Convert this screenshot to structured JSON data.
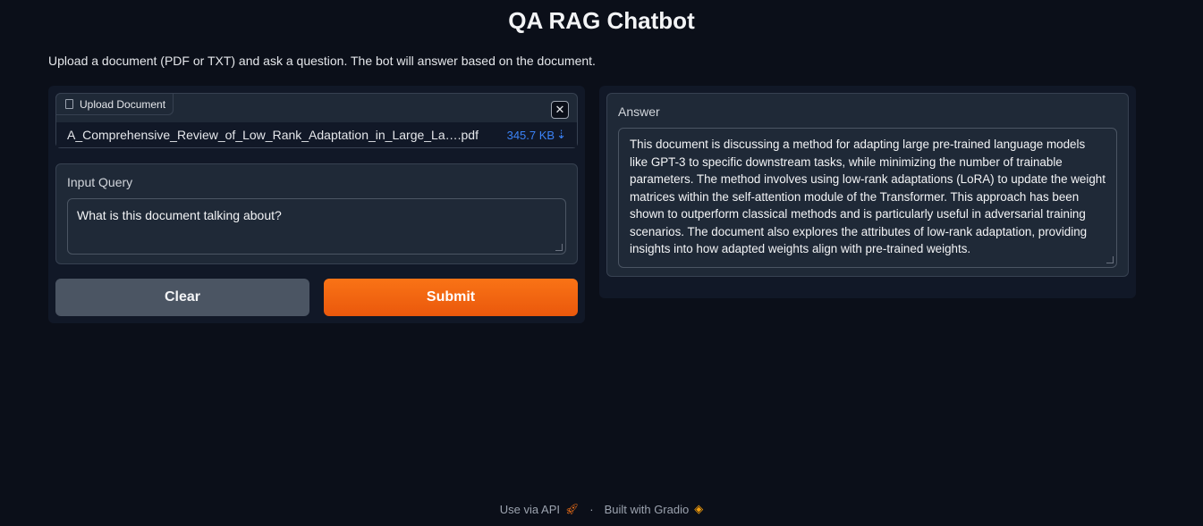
{
  "app": {
    "title": "QA RAG Chatbot",
    "description": "Upload a document (PDF or TXT) and ask a question. The bot will answer based on the document."
  },
  "upload": {
    "label": "Upload Document",
    "file_name": "A_Comprehensive_Review_of_Low_Rank_Adaptation_in_Large_La….pdf",
    "file_size": "345.7 KB",
    "close_symbol": "✕",
    "download_symbol": "⇣"
  },
  "query": {
    "label": "Input Query",
    "value": "What is this document talking about?"
  },
  "buttons": {
    "clear": "Clear",
    "submit": "Submit"
  },
  "answer": {
    "label": "Answer",
    "value": " This document is discussing a method for adapting large pre-trained language models like GPT-3 to specific downstream tasks, while minimizing the number of trainable parameters. The method involves using low-rank adaptations (LoRA) to update the weight matrices within the self-attention module of the Transformer. This approach has been shown to outperform classical methods and is particularly useful in adversarial training scenarios. The document also explores the attributes of low-rank adaptation, providing insights into how adapted weights align with pre-trained weights."
  },
  "footer": {
    "api_label": "Use via API",
    "separator": "·",
    "built_label": "Built with Gradio",
    "api_icon": "rocket-icon",
    "built_icon": "gradio-logo-icon"
  },
  "colors": {
    "background": "#0b0f19",
    "accent": "#f97316",
    "link": "#3b82f6"
  }
}
